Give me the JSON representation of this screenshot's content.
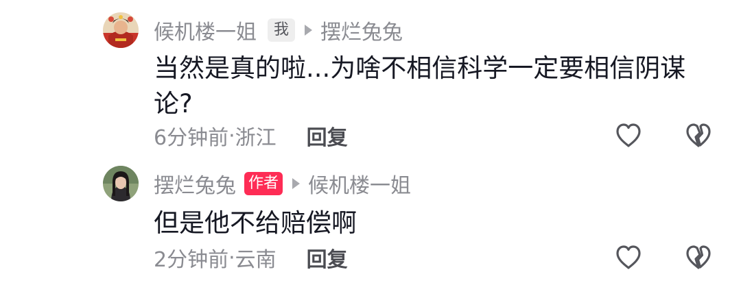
{
  "comments": [
    {
      "author": "候机楼一姐",
      "badge": "我",
      "reply_to": "摆烂兔兔",
      "text": "当然是真的啦...为啥不相信科学一定要相信阴谋论?",
      "time": "6分钟前",
      "location": "浙江",
      "reply_label": "回复",
      "avatar": "avatar-red-costume",
      "colors": {
        "badge_bg": "#eeeeee",
        "badge_text": "#55565c"
      }
    },
    {
      "author": "摆烂兔兔",
      "badge": "作者",
      "reply_to": "候机楼一姐",
      "text": "但是他不给赔偿啊",
      "time": "2分钟前",
      "location": "云南",
      "reply_label": "回复",
      "avatar": "avatar-girl-dark-hair",
      "colors": {
        "badge_bg": "#fe2c55",
        "badge_text": "#ffffff"
      }
    }
  ],
  "icons": {
    "like": "heart-outline-icon",
    "dislike": "broken-heart-outline-icon",
    "reply_pointer": "triangle-right-icon"
  },
  "colors": {
    "meta_gray": "#8a8b91",
    "text_dark": "#161823",
    "icon_gray": "#55565c",
    "accent": "#fe2c55"
  }
}
